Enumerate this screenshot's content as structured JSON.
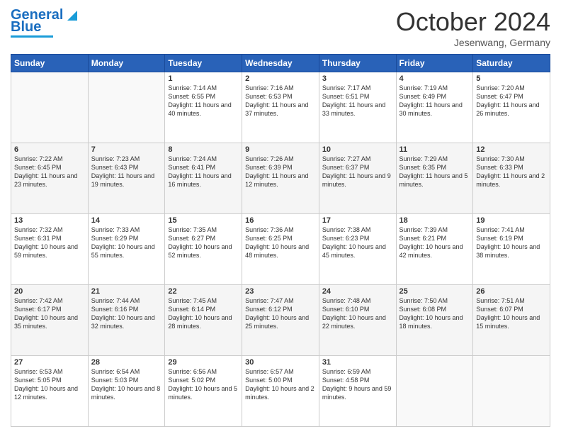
{
  "header": {
    "logo_line1": "General",
    "logo_line2": "Blue",
    "month": "October 2024",
    "location": "Jesenwang, Germany"
  },
  "days_of_week": [
    "Sunday",
    "Monday",
    "Tuesday",
    "Wednesday",
    "Thursday",
    "Friday",
    "Saturday"
  ],
  "weeks": [
    [
      {
        "day": "",
        "info": ""
      },
      {
        "day": "",
        "info": ""
      },
      {
        "day": "1",
        "info": "Sunrise: 7:14 AM\nSunset: 6:55 PM\nDaylight: 11 hours and 40 minutes."
      },
      {
        "day": "2",
        "info": "Sunrise: 7:16 AM\nSunset: 6:53 PM\nDaylight: 11 hours and 37 minutes."
      },
      {
        "day": "3",
        "info": "Sunrise: 7:17 AM\nSunset: 6:51 PM\nDaylight: 11 hours and 33 minutes."
      },
      {
        "day": "4",
        "info": "Sunrise: 7:19 AM\nSunset: 6:49 PM\nDaylight: 11 hours and 30 minutes."
      },
      {
        "day": "5",
        "info": "Sunrise: 7:20 AM\nSunset: 6:47 PM\nDaylight: 11 hours and 26 minutes."
      }
    ],
    [
      {
        "day": "6",
        "info": "Sunrise: 7:22 AM\nSunset: 6:45 PM\nDaylight: 11 hours and 23 minutes."
      },
      {
        "day": "7",
        "info": "Sunrise: 7:23 AM\nSunset: 6:43 PM\nDaylight: 11 hours and 19 minutes."
      },
      {
        "day": "8",
        "info": "Sunrise: 7:24 AM\nSunset: 6:41 PM\nDaylight: 11 hours and 16 minutes."
      },
      {
        "day": "9",
        "info": "Sunrise: 7:26 AM\nSunset: 6:39 PM\nDaylight: 11 hours and 12 minutes."
      },
      {
        "day": "10",
        "info": "Sunrise: 7:27 AM\nSunset: 6:37 PM\nDaylight: 11 hours and 9 minutes."
      },
      {
        "day": "11",
        "info": "Sunrise: 7:29 AM\nSunset: 6:35 PM\nDaylight: 11 hours and 5 minutes."
      },
      {
        "day": "12",
        "info": "Sunrise: 7:30 AM\nSunset: 6:33 PM\nDaylight: 11 hours and 2 minutes."
      }
    ],
    [
      {
        "day": "13",
        "info": "Sunrise: 7:32 AM\nSunset: 6:31 PM\nDaylight: 10 hours and 59 minutes."
      },
      {
        "day": "14",
        "info": "Sunrise: 7:33 AM\nSunset: 6:29 PM\nDaylight: 10 hours and 55 minutes."
      },
      {
        "day": "15",
        "info": "Sunrise: 7:35 AM\nSunset: 6:27 PM\nDaylight: 10 hours and 52 minutes."
      },
      {
        "day": "16",
        "info": "Sunrise: 7:36 AM\nSunset: 6:25 PM\nDaylight: 10 hours and 48 minutes."
      },
      {
        "day": "17",
        "info": "Sunrise: 7:38 AM\nSunset: 6:23 PM\nDaylight: 10 hours and 45 minutes."
      },
      {
        "day": "18",
        "info": "Sunrise: 7:39 AM\nSunset: 6:21 PM\nDaylight: 10 hours and 42 minutes."
      },
      {
        "day": "19",
        "info": "Sunrise: 7:41 AM\nSunset: 6:19 PM\nDaylight: 10 hours and 38 minutes."
      }
    ],
    [
      {
        "day": "20",
        "info": "Sunrise: 7:42 AM\nSunset: 6:17 PM\nDaylight: 10 hours and 35 minutes."
      },
      {
        "day": "21",
        "info": "Sunrise: 7:44 AM\nSunset: 6:16 PM\nDaylight: 10 hours and 32 minutes."
      },
      {
        "day": "22",
        "info": "Sunrise: 7:45 AM\nSunset: 6:14 PM\nDaylight: 10 hours and 28 minutes."
      },
      {
        "day": "23",
        "info": "Sunrise: 7:47 AM\nSunset: 6:12 PM\nDaylight: 10 hours and 25 minutes."
      },
      {
        "day": "24",
        "info": "Sunrise: 7:48 AM\nSunset: 6:10 PM\nDaylight: 10 hours and 22 minutes."
      },
      {
        "day": "25",
        "info": "Sunrise: 7:50 AM\nSunset: 6:08 PM\nDaylight: 10 hours and 18 minutes."
      },
      {
        "day": "26",
        "info": "Sunrise: 7:51 AM\nSunset: 6:07 PM\nDaylight: 10 hours and 15 minutes."
      }
    ],
    [
      {
        "day": "27",
        "info": "Sunrise: 6:53 AM\nSunset: 5:05 PM\nDaylight: 10 hours and 12 minutes."
      },
      {
        "day": "28",
        "info": "Sunrise: 6:54 AM\nSunset: 5:03 PM\nDaylight: 10 hours and 8 minutes."
      },
      {
        "day": "29",
        "info": "Sunrise: 6:56 AM\nSunset: 5:02 PM\nDaylight: 10 hours and 5 minutes."
      },
      {
        "day": "30",
        "info": "Sunrise: 6:57 AM\nSunset: 5:00 PM\nDaylight: 10 hours and 2 minutes."
      },
      {
        "day": "31",
        "info": "Sunrise: 6:59 AM\nSunset: 4:58 PM\nDaylight: 9 hours and 59 minutes."
      },
      {
        "day": "",
        "info": ""
      },
      {
        "day": "",
        "info": ""
      }
    ]
  ]
}
